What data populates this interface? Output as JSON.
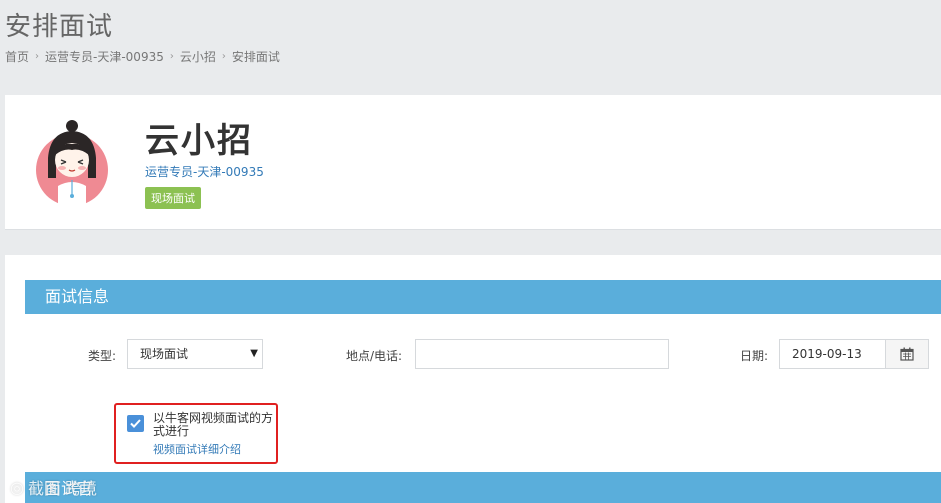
{
  "page": {
    "title": "安排面试"
  },
  "breadcrumb": [
    "首页",
    "运营专员-天津-00935",
    "云小招",
    "安排面试"
  ],
  "profile": {
    "name": "云小招",
    "job": "运营专员-天津-00935",
    "badge": "现场面试"
  },
  "interview": {
    "section_title": "面试信息",
    "type_label": "类型:",
    "type_value": "现场面试",
    "location_label": "地点/电话:",
    "location_value": "",
    "date_label": "日期:",
    "date_value": "2019-09-13",
    "video_option_text": "以牛客网视频面试的方式进行",
    "video_option_link": "视频面试详细介绍",
    "video_option_checked": true
  },
  "next_section": {
    "title": "面试官"
  },
  "watermark": {
    "text": "截图 跨境"
  },
  "colors": {
    "accent": "#5aaedb",
    "badge": "#8cc152",
    "link": "#337ab7",
    "highlight": "#e02020"
  }
}
